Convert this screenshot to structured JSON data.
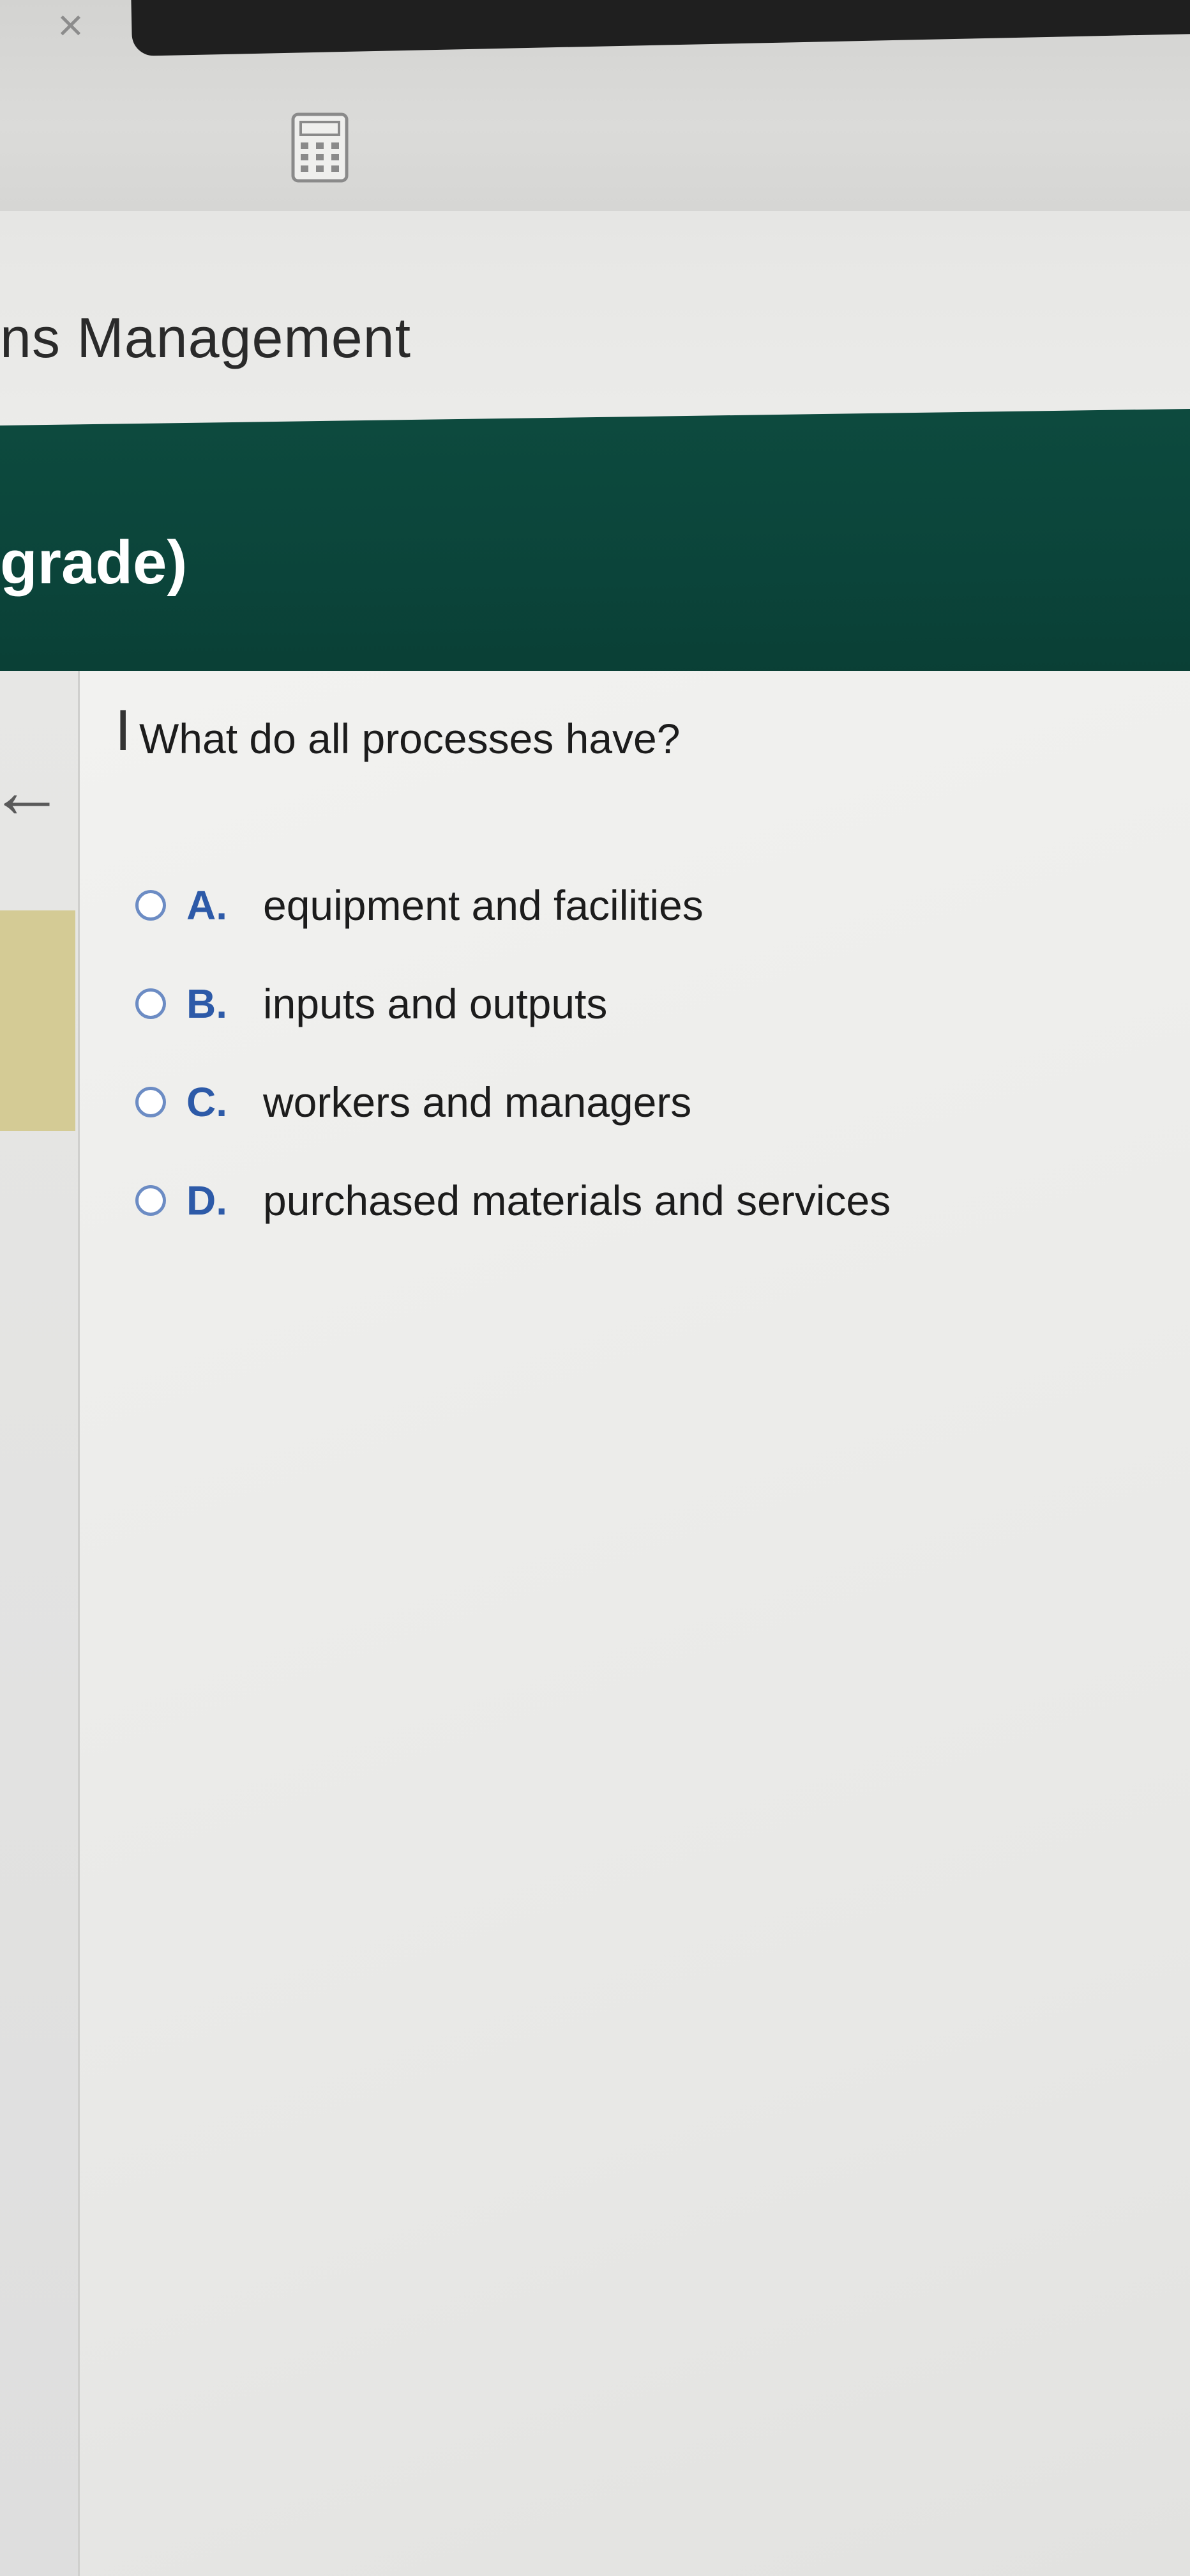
{
  "window": {
    "close_symbol": "×"
  },
  "toolbar": {
    "calculator_icon": "calculator-icon"
  },
  "course": {
    "title": "ns Management"
  },
  "assignment": {
    "header_text": "grade)"
  },
  "navigation": {
    "back_symbol": "←"
  },
  "question": {
    "cursor_symbol": "I",
    "prompt": "What do all processes have?",
    "options": [
      {
        "letter": "A.",
        "text": "equipment and facilities"
      },
      {
        "letter": "B.",
        "text": "inputs and outputs"
      },
      {
        "letter": "C.",
        "text": "workers and managers"
      },
      {
        "letter": "D.",
        "text": "purchased materials and services"
      }
    ]
  },
  "colors": {
    "header_green": "#0b443a",
    "nav_highlight": "#d4cb95",
    "option_letter": "#2d5aa8",
    "radio_border": "#6c8cc4"
  }
}
